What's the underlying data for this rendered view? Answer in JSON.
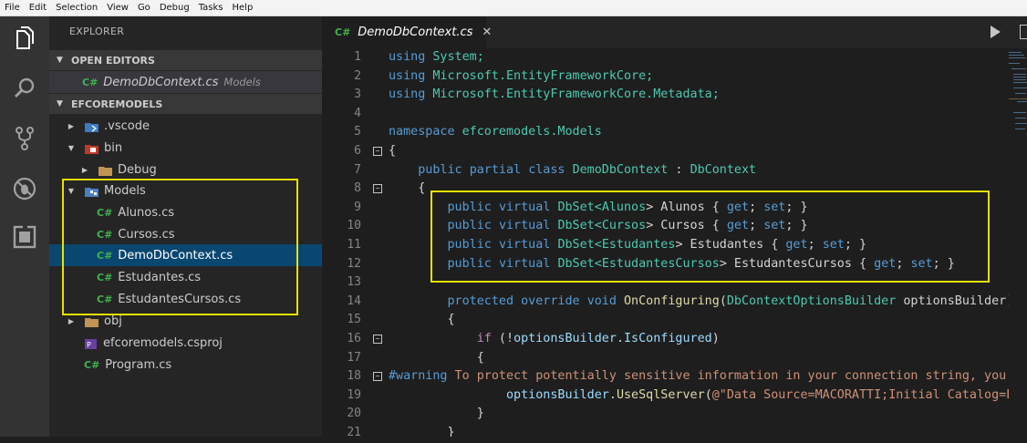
{
  "menu": [
    "File",
    "Edit",
    "Selection",
    "View",
    "Go",
    "Debug",
    "Tasks",
    "Help"
  ],
  "activity_icons": [
    "files-icon",
    "search-icon",
    "source-control-icon",
    "debug-icon",
    "extensions-icon"
  ],
  "sidebar": {
    "title": "EXPLORER",
    "open_editors": {
      "label": "OPEN EDITORS",
      "item": {
        "badge": "C#",
        "name": "DemoDbContext.cs",
        "folder": "Models"
      }
    },
    "project": {
      "label": "EFCOREMODELS",
      "tree": [
        {
          "name": ".vscode",
          "twisty": "▶",
          "kind": "vscode-folder"
        },
        {
          "name": "bin",
          "twisty": "▼",
          "kind": "bin-folder"
        },
        {
          "name": "Debug",
          "twisty": "▶",
          "kind": "folder"
        },
        {
          "name": "Models",
          "twisty": "▼",
          "kind": "models-folder"
        },
        {
          "name": "Alunos.cs",
          "badge": "C#"
        },
        {
          "name": "Cursos.cs",
          "badge": "C#"
        },
        {
          "name": "DemoDbContext.cs",
          "badge": "C#",
          "selected": true
        },
        {
          "name": "Estudantes.cs",
          "badge": "C#"
        },
        {
          "name": "EstudantesCursos.cs",
          "badge": "C#"
        },
        {
          "name": "obj",
          "twisty": "▶",
          "kind": "folder"
        },
        {
          "name": "efcoremodels.csproj",
          "kind": "csproj"
        },
        {
          "name": "Program.cs",
          "badge": "C#"
        }
      ]
    }
  },
  "editor": {
    "tab": {
      "badge": "C#",
      "name": "DemoDbContext.cs",
      "close": "✕"
    },
    "line_numbers": [
      "1",
      "2",
      "3",
      "4",
      "5",
      "6",
      "7",
      "8",
      "9",
      "10",
      "11",
      "12",
      "13",
      "14",
      "15",
      "16",
      "17",
      "18",
      "19",
      "20",
      "21"
    ],
    "fold_markers": [
      "−",
      "−",
      "−",
      "−",
      "−"
    ],
    "code": {
      "l1": [
        "using",
        " System;"
      ],
      "l2": [
        "using",
        " Microsoft.EntityFrameworkCore;"
      ],
      "l3": [
        "using",
        " Microsoft.EntityFrameworkCore.Metadata;"
      ],
      "l5": [
        "namespace",
        " efcoremodels.Models"
      ],
      "l6": "{",
      "l7": [
        "    ",
        "public",
        " ",
        "partial",
        " ",
        "class",
        " ",
        "DemoDbContext",
        " : ",
        "DbContext"
      ],
      "l8": "    {",
      "l9": [
        "        ",
        "public",
        " ",
        "virtual",
        " ",
        "DbSet",
        "<",
        "Alunos",
        "> Alunos { ",
        "get",
        "; ",
        "set",
        "; }"
      ],
      "l10": [
        "        ",
        "public",
        " ",
        "virtual",
        " ",
        "DbSet",
        "<",
        "Cursos",
        "> Cursos { ",
        "get",
        "; ",
        "set",
        "; }"
      ],
      "l11": [
        "        ",
        "public",
        " ",
        "virtual",
        " ",
        "DbSet",
        "<",
        "Estudantes",
        "> Estudantes { ",
        "get",
        "; ",
        "set",
        "; }"
      ],
      "l12": [
        "        ",
        "public",
        " ",
        "virtual",
        " ",
        "DbSet",
        "<",
        "EstudantesCursos",
        "> EstudantesCursos { ",
        "get",
        "; ",
        "set",
        "; }"
      ],
      "l14": [
        "        ",
        "protected",
        " ",
        "override",
        " ",
        "void",
        " ",
        "OnConfiguring",
        "(",
        "DbContextOptionsBuilder",
        " optionsBuilder)"
      ],
      "l15": "        {",
      "l16": [
        "            ",
        "if",
        " (!",
        "optionsBuilder",
        ".",
        "IsConfigured",
        ")"
      ],
      "l17": "            {",
      "l18": [
        "#warning",
        " To protect potentially sensitive information in your connection string, you should move it out of source code."
      ],
      "l19": [
        "                ",
        "optionsBuilder",
        ".",
        "UseSqlServer",
        "(",
        "@\"Data Source=MACORATTI;Initial Catalog=Escola;Integrated Security=True\"",
        ");"
      ],
      "l20": "            }",
      "l21": "        }"
    }
  },
  "colors": {
    "highlight": "#e5e200",
    "selection": "#094771",
    "csharp": "#3fb34f"
  }
}
